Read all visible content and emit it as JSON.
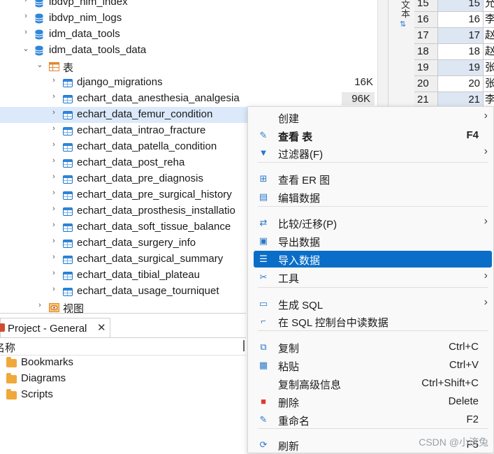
{
  "tree": {
    "items": [
      {
        "label": "ibdvp_nim_index",
        "type": "db",
        "twisty": "›"
      },
      {
        "label": "ibdvp_nim_logs",
        "type": "db",
        "twisty": "›"
      },
      {
        "label": "idm_data_tools",
        "type": "db",
        "twisty": "›"
      },
      {
        "label": "idm_data_tools_data",
        "type": "db",
        "twisty": "⌄"
      },
      {
        "label": "表",
        "type": "folder",
        "twisty": "⌄"
      },
      {
        "label": "django_migrations",
        "type": "table",
        "twisty": "›",
        "size": "16K"
      },
      {
        "label": "echart_data_anesthesia_analgesia",
        "type": "table",
        "twisty": "›",
        "size": "96K"
      },
      {
        "label": "echart_data_femur_condition",
        "type": "table",
        "twisty": "›",
        "selected": true
      },
      {
        "label": "echart_data_intrao_fracture",
        "type": "table",
        "twisty": "›"
      },
      {
        "label": "echart_data_patella_condition",
        "type": "table",
        "twisty": "›"
      },
      {
        "label": "echart_data_post_reha",
        "type": "table",
        "twisty": "›"
      },
      {
        "label": "echart_data_pre_diagnosis",
        "type": "table",
        "twisty": "›"
      },
      {
        "label": "echart_data_pre_surgical_history",
        "type": "table",
        "twisty": "›"
      },
      {
        "label": "echart_data_prosthesis_installatio",
        "type": "table",
        "twisty": "›"
      },
      {
        "label": "echart_data_soft_tissue_balance",
        "type": "table",
        "twisty": "›"
      },
      {
        "label": "echart_data_surgery_info",
        "type": "table",
        "twisty": "›"
      },
      {
        "label": "echart_data_surgical_summary",
        "type": "table",
        "twisty": "›"
      },
      {
        "label": "echart_data_tibial_plateau",
        "type": "table",
        "twisty": "›"
      },
      {
        "label": "echart_data_usage_tourniquet",
        "type": "table",
        "twisty": "›"
      },
      {
        "label": "视图",
        "type": "view",
        "twisty": "›"
      }
    ]
  },
  "side_panel": {
    "label": "文本"
  },
  "grid": {
    "rows": [
      {
        "num": "15",
        "value": "15",
        "extra": "允"
      },
      {
        "num": "16",
        "value": "16",
        "extra": "李"
      },
      {
        "num": "17",
        "value": "17",
        "extra": "赵"
      },
      {
        "num": "18",
        "value": "18",
        "extra": "赵"
      },
      {
        "num": "19",
        "value": "19",
        "extra": "张"
      },
      {
        "num": "20",
        "value": "20",
        "extra": "张"
      },
      {
        "num": "21",
        "value": "21",
        "extra": "李"
      }
    ]
  },
  "project": {
    "tab_label": "Project - General",
    "close": "✕",
    "column_header": "名称",
    "items": [
      {
        "label": "Bookmarks"
      },
      {
        "label": "Diagrams"
      },
      {
        "label": "Scripts"
      }
    ]
  },
  "menu": {
    "items": [
      {
        "label": "创建",
        "icon": "",
        "submenu": true
      },
      {
        "label": "查看 表",
        "icon": "pencil-icon",
        "shortcut": "F4",
        "bold": true
      },
      {
        "label": "过滤器(F)",
        "icon": "filter-icon",
        "submenu": true
      },
      {
        "label": "查看 ER 图",
        "icon": "er-diagram-icon"
      },
      {
        "label": "编辑数据",
        "icon": "edit-data-icon"
      },
      {
        "label": "比较/迁移(P)",
        "icon": "compare-icon",
        "submenu": true
      },
      {
        "label": "导出数据",
        "icon": "export-icon"
      },
      {
        "label": "导入数据",
        "icon": "import-icon",
        "active": true
      },
      {
        "label": "工具",
        "icon": "tools-icon",
        "submenu": true
      },
      {
        "label": "生成 SQL",
        "icon": "sql-icon",
        "submenu": true
      },
      {
        "label": "在 SQL 控制台中读数据",
        "icon": "console-icon"
      },
      {
        "label": "复制",
        "icon": "copy-icon",
        "shortcut": "Ctrl+C"
      },
      {
        "label": "粘贴",
        "icon": "paste-icon",
        "shortcut": "Ctrl+V"
      },
      {
        "label": "复制高级信息",
        "icon": "",
        "shortcut": "Ctrl+Shift+C"
      },
      {
        "label": "删除",
        "icon": "delete-icon",
        "shortcut": "Delete"
      },
      {
        "label": "重命名",
        "icon": "rename-icon",
        "shortcut": "F2"
      },
      {
        "label": "刷新",
        "icon": "refresh-icon",
        "shortcut": "F5"
      }
    ]
  },
  "watermark": "CSDN @小济兔",
  "colors": {
    "selection": "#dbe9fb",
    "menu_active": "#0a6ec8",
    "table_icon": "#2f86d9",
    "folder_icon": "#f0a83a"
  }
}
